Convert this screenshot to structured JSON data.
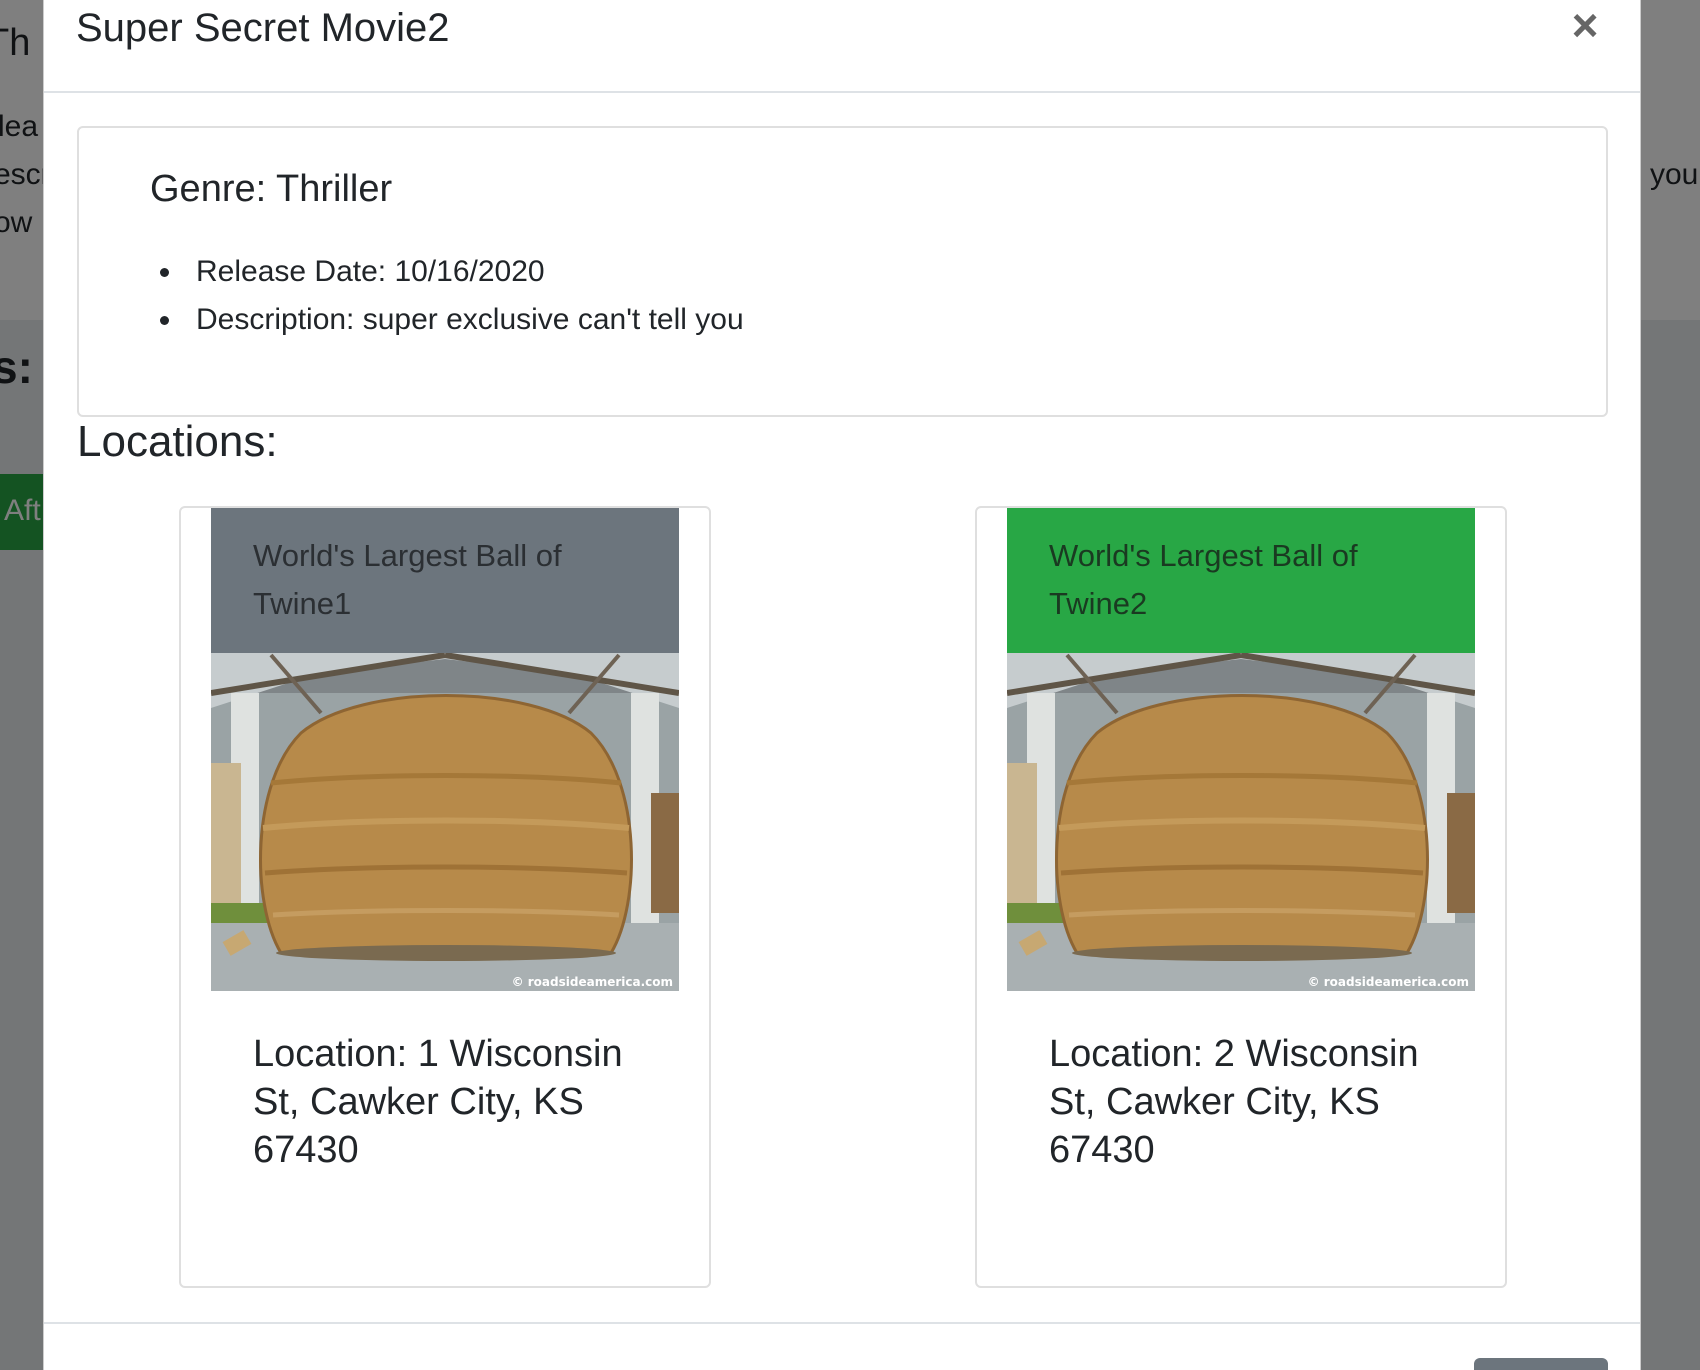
{
  "background": {
    "title_fragment": "Th",
    "line1": "lea",
    "line2": "escr",
    "line3": "ow M",
    "right_fragment": "you",
    "heading_fragment": "s:",
    "button_fragment": "Aft"
  },
  "modal": {
    "title": "Super Secret Movie2",
    "close_label": "×",
    "genre": "Genre: Thriller",
    "release_date": "Release Date: 10/16/2020",
    "description": "Description: super exclusive can't tell you",
    "locations_heading": "Locations:",
    "locations": [
      {
        "name": "World's Largest Ball of Twine1",
        "address": "Location: 1 Wisconsin St, Cawker City, KS 67430",
        "header_color": "#6c757d",
        "image_credit": "© roadsideamerica.com"
      },
      {
        "name": "World's Largest Ball of Twine2",
        "address": "Location: 2 Wisconsin St, Cawker City, KS 67430",
        "header_color": "#28a745",
        "image_credit": "© roadsideamerica.com"
      }
    ]
  }
}
